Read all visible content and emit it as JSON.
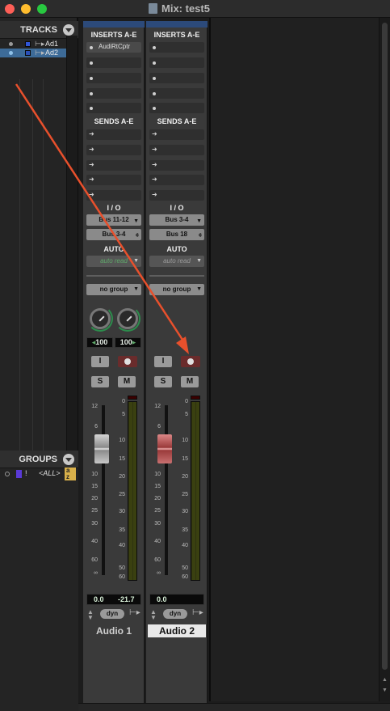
{
  "window": {
    "title": "Mix: test5"
  },
  "tracks_panel": {
    "header": "TRACKS",
    "items": [
      {
        "name": "Ad1",
        "selected": false
      },
      {
        "name": "Ad2",
        "selected": true
      }
    ]
  },
  "groups_panel": {
    "header": "GROUPS",
    "items": [
      {
        "id": "!",
        "name": "<ALL>"
      }
    ],
    "sort_icon": "az"
  },
  "strips": [
    {
      "inserts_title": "INSERTS A-E",
      "inserts": [
        "AudiRtCptr",
        "",
        "",
        "",
        ""
      ],
      "sends_title": "SENDS A-E",
      "io_title": "I / O",
      "input": "Bus 11-12",
      "output": "Bus 3-4",
      "auto_title": "AUTO",
      "auto_mode": "auto read",
      "group": "no group",
      "pan_left": "100",
      "pan_right": "100",
      "input_monitor": "I",
      "solo": "S",
      "mute": "M",
      "volume": "0.0",
      "peak": "-21.7",
      "dyn": "dyn",
      "name": "Audio 1"
    },
    {
      "inserts_title": "INSERTS A-E",
      "inserts": [
        "",
        "",
        "",
        "",
        ""
      ],
      "sends_title": "SENDS A-E",
      "io_title": "I / O",
      "input": "Bus 3-4",
      "output": "Bus 18",
      "auto_title": "AUTO",
      "auto_mode": "auto read",
      "group": "no group",
      "input_monitor": "I",
      "solo": "S",
      "mute": "M",
      "volume": "0.0",
      "dyn": "dyn",
      "name": "Audio 2"
    }
  ],
  "fader_scale": [
    "12",
    "6",
    "0",
    "5",
    "10",
    "15",
    "20",
    "25",
    "30",
    "40",
    "60",
    "∞"
  ],
  "meter_scale": [
    "0",
    "5",
    "10",
    "15",
    "20",
    "25",
    "30",
    "35",
    "40",
    "50",
    "60"
  ],
  "colors": {
    "accent_blue": "#3d6b98",
    "annotation": "#e8502c",
    "auto_read_green": "#5fa86a",
    "fader_red": "#b84a4a"
  }
}
